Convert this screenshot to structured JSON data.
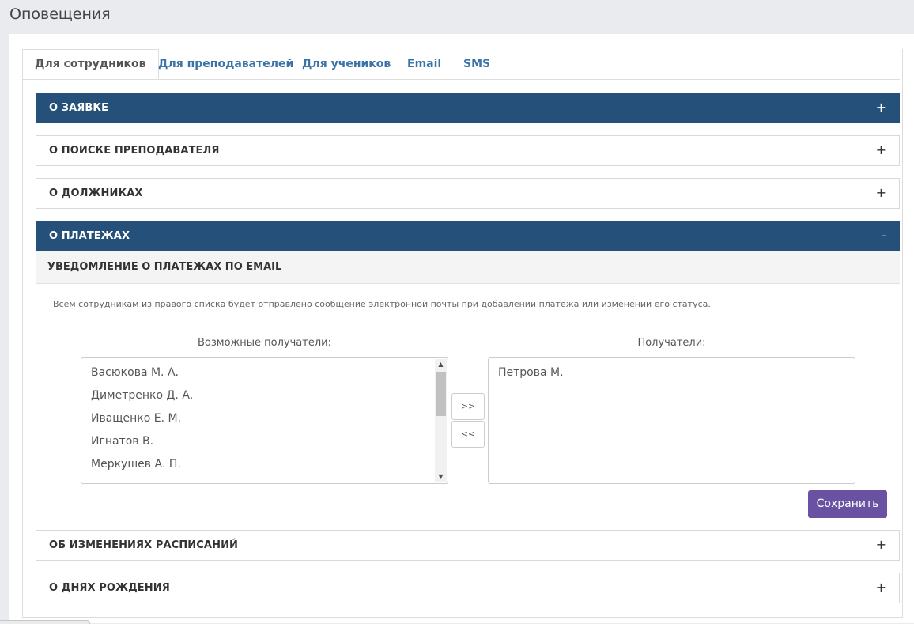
{
  "page": {
    "title": "Оповещения"
  },
  "tabs": [
    {
      "label": "Для сотрудников",
      "active": true
    },
    {
      "label": "Для преподавателей",
      "active": false
    },
    {
      "label": "Для учеников",
      "active": false
    },
    {
      "label": "Email",
      "active": false
    },
    {
      "label": "SMS",
      "active": false
    }
  ],
  "accordion": [
    {
      "title": "О ЗАЯВКЕ",
      "sign": "+",
      "state": "collapsed-highlighted"
    },
    {
      "title": "О ПОИСКЕ ПРЕПОДАВАТЕЛЯ",
      "sign": "+",
      "state": "collapsed"
    },
    {
      "title": "О ДОЛЖНИКАХ",
      "sign": "+",
      "state": "collapsed"
    },
    {
      "title": "О ПЛАТЕЖАХ",
      "sign": "-",
      "state": "expanded"
    },
    {
      "title": "ОБ ИЗМЕНЕНИЯХ РАСПИСАНИЙ",
      "sign": "+",
      "state": "collapsed"
    },
    {
      "title": "О ДНЯХ РОЖДЕНИЯ",
      "sign": "+",
      "state": "collapsed"
    }
  ],
  "payments": {
    "subheading": "УВЕДОМЛЕНИЕ О ПЛАТЕЖАХ ПО EMAIL",
    "hint": "Всем сотрудникам из правого списка будет отправлено сообщение электронной почты при добавлении платежа или изменении его статуса.",
    "available_label": "Возможные получатели:",
    "recipients_label": "Получатели:",
    "available": [
      "Васюкова М. А.",
      "Диметренко Д. А.",
      "Иващенко Е. М.",
      "Игнатов В.",
      "Меркушев А. П."
    ],
    "recipients": [
      "Петрова М."
    ],
    "move_right": ">>",
    "move_left": "<<",
    "save_label": "Сохранить"
  },
  "icons": {
    "scroll_up": "up-arrow-icon",
    "scroll_down": "down-arrow-icon"
  },
  "colors": {
    "accordion_dark": "#245079",
    "tab_link": "#3a73a8",
    "save_button": "#6a52a3"
  }
}
